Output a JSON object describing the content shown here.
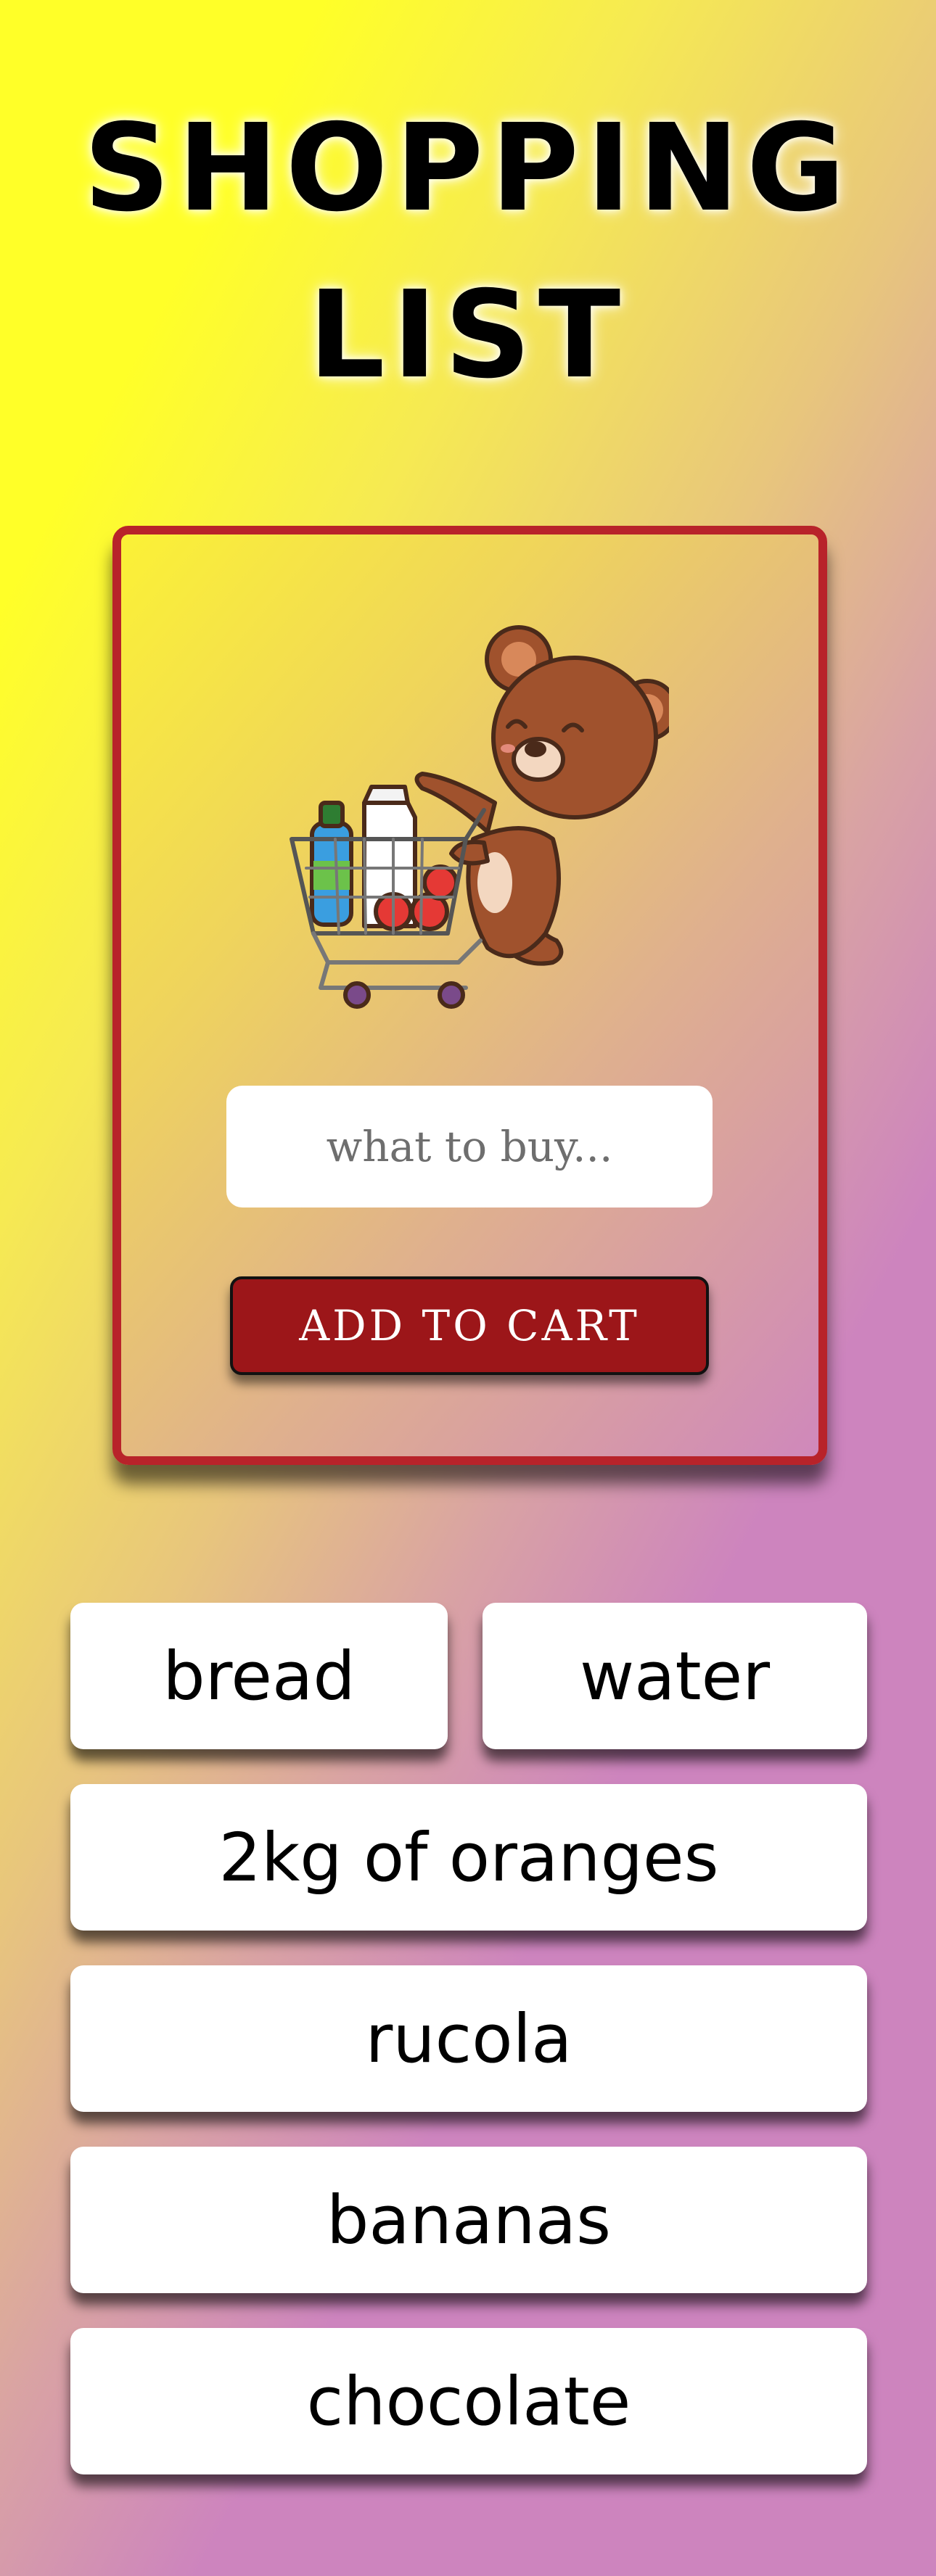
{
  "header": {
    "title_line1": "SHOPPING",
    "title_line2": "LIST"
  },
  "form": {
    "mascot_icon": "bear-pushing-shopping-cart-illustration",
    "input_placeholder": "what to buy...",
    "input_value": "",
    "add_button_label": "ADD TO CART"
  },
  "colors": {
    "card_border": "#b8232a",
    "button_bg": "#9c1619",
    "item_bg": "#ffffff"
  },
  "list": {
    "items": [
      {
        "label": "bread"
      },
      {
        "label": "water"
      },
      {
        "label": "2kg of oranges"
      },
      {
        "label": "rucola"
      },
      {
        "label": "bananas"
      },
      {
        "label": "chocolate"
      }
    ]
  }
}
